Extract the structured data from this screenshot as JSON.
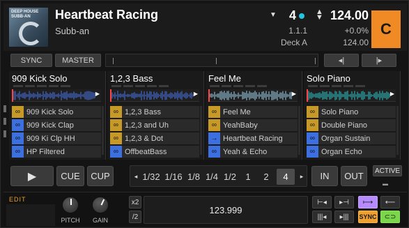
{
  "header": {
    "cover_text": "DEEP HOUSE\nSUBB-AN",
    "title": "Heartbeat Racing",
    "artist": "Subb-an",
    "beat": "4",
    "bpm": "124.00",
    "position": "1.1.1",
    "tempo": "+0.0%",
    "deck_name": "Deck A",
    "bpm_secondary": "124.00",
    "deck_letter": "C",
    "deck_color": "#f08a24",
    "beat_dot_color": "#22c6e0"
  },
  "strip": {
    "sync_label": "SYNC",
    "master_label": "MASTER",
    "prev_label": "◂|",
    "next_label": "|▸"
  },
  "slots": [
    {
      "name": "909 Kick Solo",
      "wave_color": "#4a74e8",
      "cells": [
        {
          "label": "909 Kick Solo",
          "color": "#c79a28",
          "icon": "loop"
        },
        {
          "label": "909 Kick Clap",
          "color": "#3c6fe0",
          "icon": "loop"
        },
        {
          "label": "909 Ki Clp HH",
          "color": "#3c6fe0",
          "icon": "loop"
        },
        {
          "label": "HP Filtered",
          "color": "#3c6fe0",
          "icon": "loop"
        }
      ]
    },
    {
      "name": "1,2,3 Bass",
      "wave_color": "#4a74e8",
      "cells": [
        {
          "label": "1,2,3 Bass",
          "color": "#c79a28",
          "icon": "loop"
        },
        {
          "label": "1,2,3 and Uh",
          "color": "#c79a28",
          "icon": "loop"
        },
        {
          "label": "1,2,3 & Dot",
          "color": "#c79a28",
          "icon": "loop"
        },
        {
          "label": "OffbeatBass",
          "color": "#3c6fe0",
          "icon": "loop"
        }
      ]
    },
    {
      "name": "Feel Me",
      "wave_color": "#9fd6ee",
      "cells": [
        {
          "label": "Feel Me",
          "color": "#c79a28",
          "icon": "loop"
        },
        {
          "label": "YeahBaby",
          "color": "#c79a28",
          "icon": "loop"
        },
        {
          "label": "Heartbeat Racing",
          "color": "#3c6fe0",
          "icon": "oneshot"
        },
        {
          "label": "Yeah & Echo",
          "color": "#3c6fe0",
          "icon": "loop"
        }
      ]
    },
    {
      "name": "Solo Piano",
      "wave_color": "#2fc6c8",
      "cells": [
        {
          "label": "Solo Piano",
          "color": "#c79a28",
          "icon": "loop"
        },
        {
          "label": "Double Piano",
          "color": "#c79a28",
          "icon": "loop"
        },
        {
          "label": "Organ Sustain",
          "color": "#3c6fe0",
          "icon": "loop"
        },
        {
          "label": "Organ Echo",
          "color": "#3c6fe0",
          "icon": "loop"
        }
      ]
    }
  ],
  "transport": {
    "play_label": "▶",
    "cue_label": "CUE",
    "cup_label": "CUP",
    "loop_sizes": [
      "1/32",
      "1/16",
      "1/8",
      "1/4",
      "1/2",
      "1",
      "2",
      "4"
    ],
    "loop_active": "4",
    "in_label": "IN",
    "out_label": "OUT",
    "active_label": "ACTIVE"
  },
  "bottom": {
    "edit_label": "EDIT",
    "pitch_label": "PITCH",
    "gain_label": "GAIN",
    "x2_label": "x2",
    "div2_label": "/2",
    "bpm_value": "123.999",
    "sync_label": "SYNC"
  }
}
